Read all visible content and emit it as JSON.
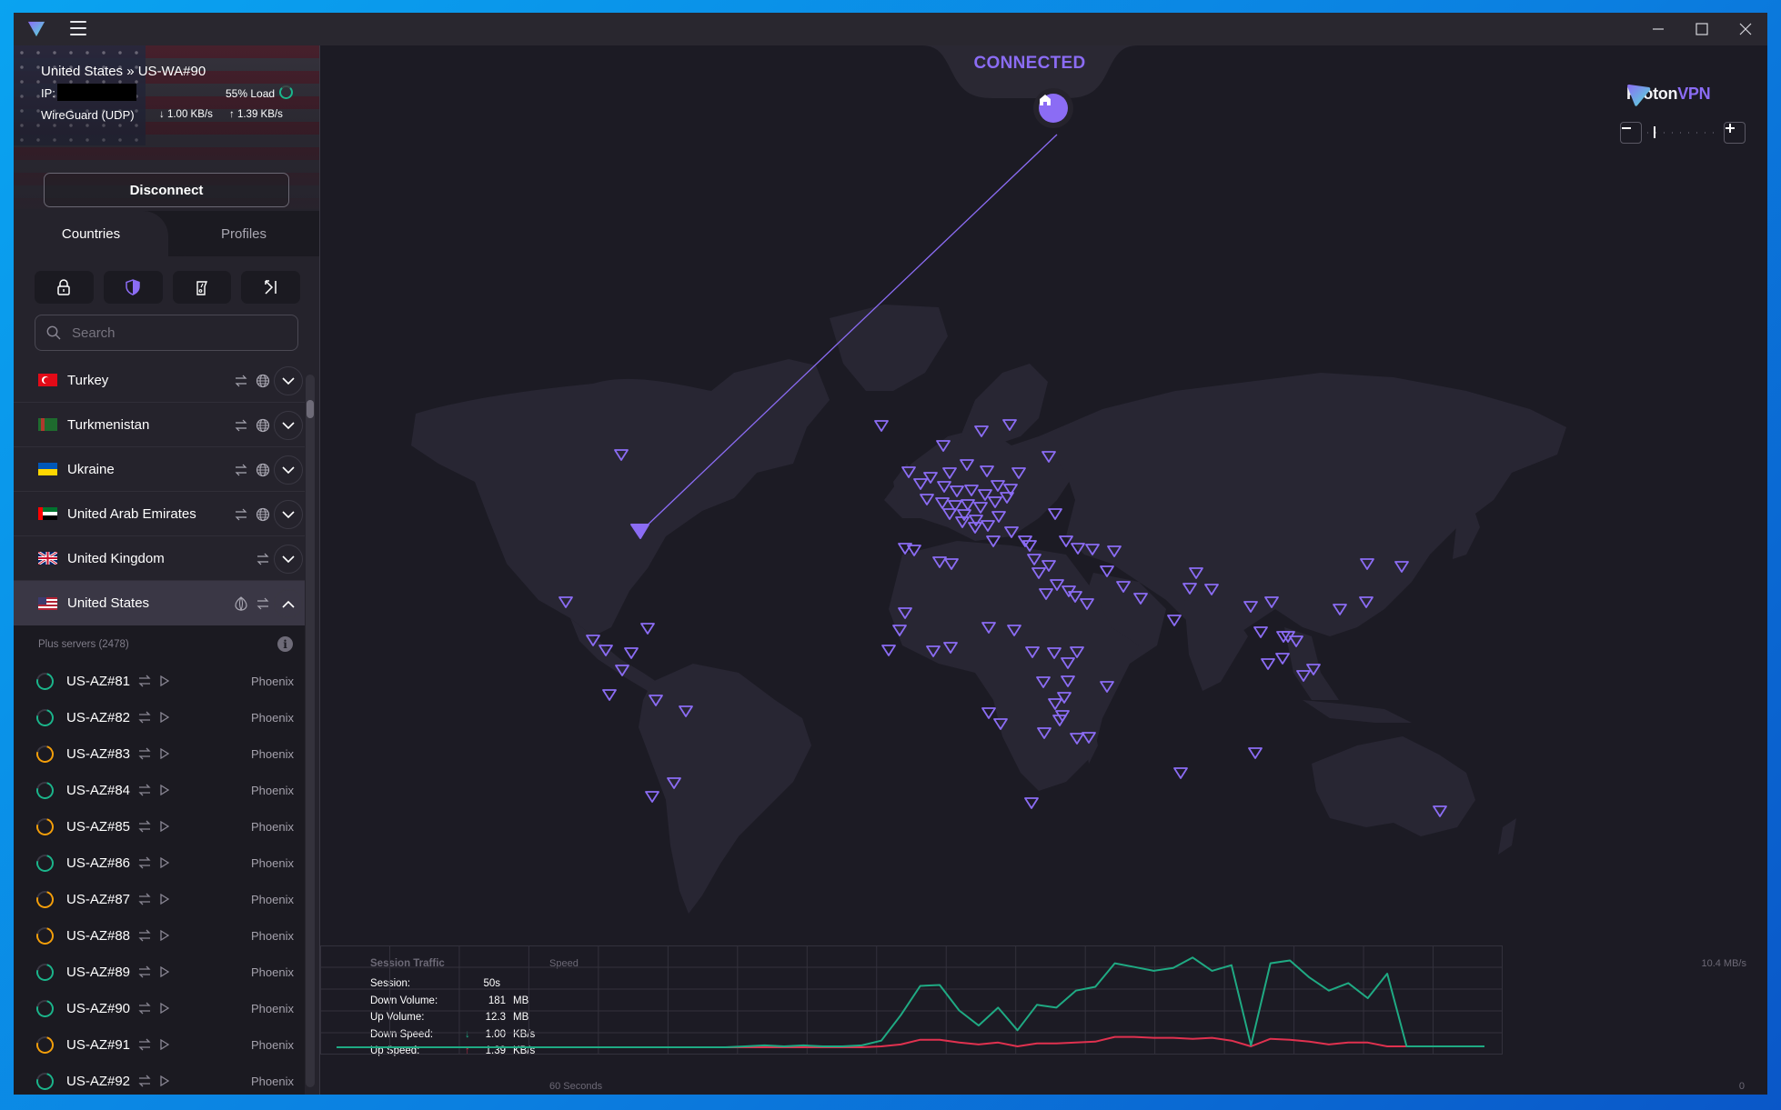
{
  "app": {
    "name": "Proton VPN",
    "brand_primary": "Proton",
    "brand_accent": "VPN",
    "accent_color": "#8b6cf4"
  },
  "window_controls": {
    "minimize": "minimize-icon",
    "maximize": "maximize-icon",
    "close": "close-icon"
  },
  "connection": {
    "title": "United States » US-WA#90",
    "ip_label": "IP:",
    "ip_value_redacted": true,
    "load": "55% Load",
    "load_percent": 55,
    "protocol": "WireGuard (UDP)",
    "down_speed": "1.00 KB/s",
    "up_speed": "1.39 KB/s",
    "disconnect_label": "Disconnect",
    "status": "CONNECTED"
  },
  "tabs": [
    {
      "label": "Countries",
      "active": true
    },
    {
      "label": "Profiles",
      "active": false
    }
  ],
  "filters": [
    {
      "icon": "lock-icon",
      "active": false
    },
    {
      "icon": "shield-icon",
      "active": true
    },
    {
      "icon": "phone-icon",
      "active": false
    },
    {
      "icon": "arrow-bar-icon",
      "active": false
    }
  ],
  "search": {
    "placeholder": "Search",
    "value": ""
  },
  "countries": [
    {
      "name": "Turkey",
      "flag": "tr",
      "features": [
        "p2p",
        "tor-globe"
      ],
      "expanded": false
    },
    {
      "name": "Turkmenistan",
      "flag": "tm",
      "features": [
        "p2p",
        "tor-globe"
      ],
      "expanded": false
    },
    {
      "name": "Ukraine",
      "flag": "ua",
      "features": [
        "p2p",
        "tor-globe"
      ],
      "expanded": false
    },
    {
      "name": "United Arab Emirates",
      "flag": "ae",
      "features": [
        "p2p",
        "tor-globe"
      ],
      "expanded": false
    },
    {
      "name": "United Kingdom",
      "flag": "gb",
      "features": [
        "p2p"
      ],
      "expanded": false
    },
    {
      "name": "United States",
      "flag": "us",
      "features": [
        "tor-onion",
        "p2p"
      ],
      "expanded": true
    }
  ],
  "servers_header": {
    "label": "Plus servers (2478)"
  },
  "servers": [
    {
      "name": "US-AZ#81",
      "city": "Phoenix",
      "load": "low"
    },
    {
      "name": "US-AZ#82",
      "city": "Phoenix",
      "load": "low"
    },
    {
      "name": "US-AZ#83",
      "city": "Phoenix",
      "load": "medium"
    },
    {
      "name": "US-AZ#84",
      "city": "Phoenix",
      "load": "low"
    },
    {
      "name": "US-AZ#85",
      "city": "Phoenix",
      "load": "medium"
    },
    {
      "name": "US-AZ#86",
      "city": "Phoenix",
      "load": "low"
    },
    {
      "name": "US-AZ#87",
      "city": "Phoenix",
      "load": "medium"
    },
    {
      "name": "US-AZ#88",
      "city": "Phoenix",
      "load": "medium"
    },
    {
      "name": "US-AZ#89",
      "city": "Phoenix",
      "load": "low"
    },
    {
      "name": "US-AZ#90",
      "city": "Phoenix",
      "load": "low"
    },
    {
      "name": "US-AZ#91",
      "city": "Phoenix",
      "load": "medium"
    },
    {
      "name": "US-AZ#92",
      "city": "Phoenix",
      "load": "low"
    }
  ],
  "load_colors": {
    "low": "#1bb58b",
    "medium": "#f59f0a"
  },
  "session_traffic": {
    "title": "Session Traffic",
    "rows": [
      {
        "label": "Session:",
        "value": "50s",
        "unit": "",
        "arrow": ""
      },
      {
        "label": "Down Volume:",
        "value": "181",
        "unit": "MB",
        "arrow": ""
      },
      {
        "label": "Up Volume:",
        "value": "12.3",
        "unit": "MB",
        "arrow": ""
      },
      {
        "label": "Down Speed:",
        "value": "1.00",
        "unit": "KB/s",
        "arrow": "↓"
      },
      {
        "label": "Up Speed:",
        "value": "1.39",
        "unit": "KB/s",
        "arrow": "↑"
      }
    ]
  },
  "chart_data": {
    "type": "line",
    "title": "Speed",
    "xlabel": "60 Seconds",
    "x_end_label": "0",
    "ymax_label": "10.4 MB/s",
    "ylim": [
      0,
      10.4
    ],
    "grid": true,
    "series": [
      {
        "name": "Down",
        "color": "#1faa83",
        "values": [
          0,
          0,
          0,
          0,
          0,
          0,
          0,
          0,
          0,
          0,
          0,
          0,
          0,
          0,
          0,
          0,
          0,
          0,
          0,
          0,
          0,
          0.1,
          0.2,
          0.1,
          0.2,
          0.1,
          0.1,
          0.2,
          0.7,
          3.4,
          6.5,
          6.6,
          3.9,
          2.3,
          4.2,
          1.8,
          4.5,
          4.2,
          6.0,
          6.4,
          8.9,
          8.5,
          8.1,
          8.4,
          9.5,
          8.1,
          8.7,
          0.2,
          8.9,
          9.2,
          7.4,
          6.0,
          6.8,
          5.2,
          7.8,
          0.1,
          0.1,
          0.1,
          0.1,
          0.1
        ]
      },
      {
        "name": "Up",
        "color": "#e0314f",
        "values": [
          0,
          0,
          0,
          0,
          0,
          0,
          0,
          0,
          0,
          0,
          0,
          0,
          0,
          0,
          0,
          0,
          0,
          0,
          0,
          0,
          0,
          0,
          0,
          0,
          0,
          0,
          0,
          0,
          0.1,
          0.3,
          0.8,
          0.8,
          0.5,
          0.3,
          0.5,
          0.1,
          0.4,
          0.4,
          0.5,
          0.6,
          1.1,
          1.1,
          1.0,
          1.0,
          0.9,
          1.0,
          0.7,
          0.1,
          0.9,
          0.8,
          0.6,
          0.3,
          0.5,
          0.5,
          0.1,
          0.1,
          0.1,
          0.1,
          0.1,
          0.1
        ]
      }
    ]
  },
  "map": {
    "connected_server_marker": "US-WA#90",
    "home_icon": "home-icon",
    "zoom_level_fraction": 0.1
  }
}
